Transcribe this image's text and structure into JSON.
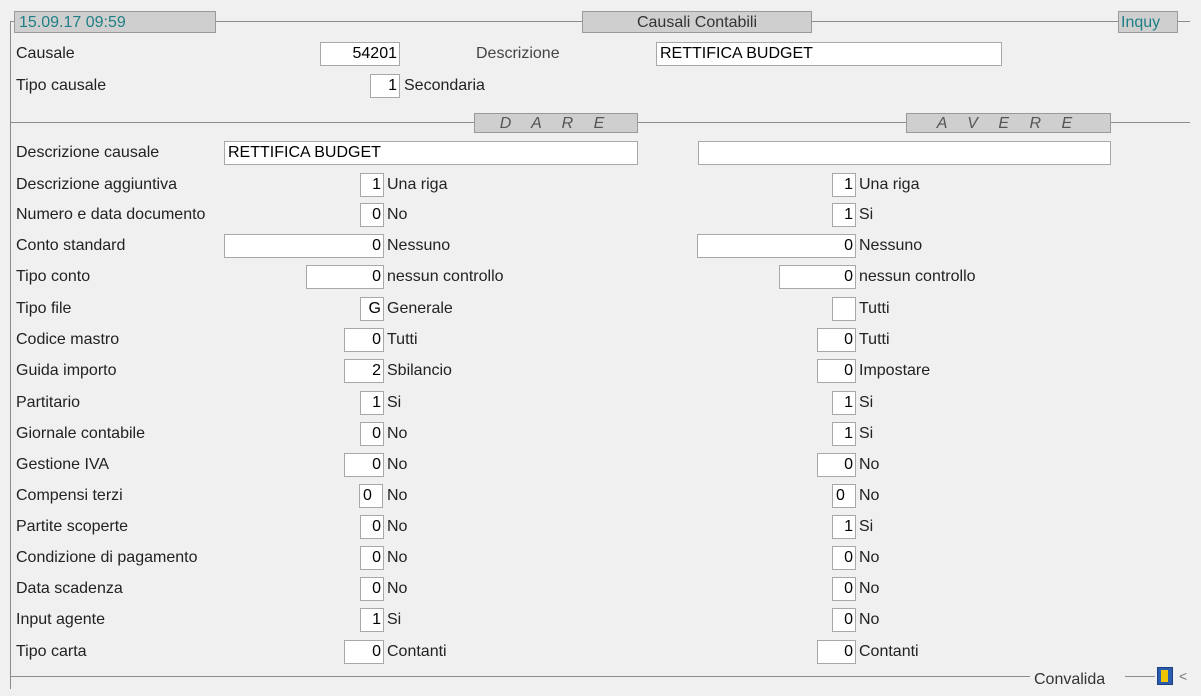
{
  "header": {
    "datetime": "15.09.17 09:59",
    "title": "Causali Contabili",
    "mode": "Inquy"
  },
  "causale": {
    "label": "Causale",
    "value": "54201"
  },
  "descrizione": {
    "label": "Descrizione",
    "value": "RETTIFICA BUDGET"
  },
  "tipo_causale": {
    "label": "Tipo causale",
    "code": "1",
    "text": "Secondaria"
  },
  "sections": {
    "dare": "D A R E",
    "avere": "A V E R E"
  },
  "rows": [
    {
      "label": "Descrizione causale",
      "dare_value": "RETTIFICA BUDGET",
      "avere_value": ""
    },
    {
      "label": "Descrizione aggiuntiva",
      "dare_code": "1",
      "dare_text": "Una riga",
      "avere_code": "1",
      "avere_text": "Una riga"
    },
    {
      "label": "Numero e data documento",
      "dare_code": "0",
      "dare_text": "No",
      "avere_code": "1",
      "avere_text": "Si"
    },
    {
      "label": "Conto standard",
      "dare_code": "0",
      "dare_text": "Nessuno",
      "avere_code": "0",
      "avere_text": "Nessuno"
    },
    {
      "label": "Tipo conto",
      "dare_code": "0",
      "dare_text": "nessun controllo",
      "avere_code": "0",
      "avere_text": "nessun controllo"
    },
    {
      "label": "Tipo file",
      "dare_code": "G",
      "dare_text": "Generale",
      "avere_code": "",
      "avere_text": "Tutti"
    },
    {
      "label": "Codice mastro",
      "dare_code": "0",
      "dare_text": "Tutti",
      "avere_code": "0",
      "avere_text": "Tutti"
    },
    {
      "label": "Guida importo",
      "dare_code": "2",
      "dare_text": "Sbilancio",
      "avere_code": "0",
      "avere_text": "Impostare"
    },
    {
      "label": "Partitario",
      "dare_code": "1",
      "dare_text": "Si",
      "avere_code": "1",
      "avere_text": "Si"
    },
    {
      "label": "Giornale contabile",
      "dare_code": "0",
      "dare_text": "No",
      "avere_code": "1",
      "avere_text": "Si"
    },
    {
      "label": "Gestione IVA",
      "dare_code": "0",
      "dare_text": "No",
      "avere_code": "0",
      "avere_text": "No"
    },
    {
      "label": "Compensi terzi",
      "dare_code": "0",
      "dare_text": "No",
      "avere_code": "0",
      "avere_text": "No"
    },
    {
      "label": "Partite scoperte",
      "dare_code": "0",
      "dare_text": "No",
      "avere_code": "1",
      "avere_text": "Si"
    },
    {
      "label": "Condizione di pagamento",
      "dare_code": "0",
      "dare_text": "No",
      "avere_code": "0",
      "avere_text": "No"
    },
    {
      "label": "Data scadenza",
      "dare_code": "0",
      "dare_text": "No",
      "avere_code": "0",
      "avere_text": "No"
    },
    {
      "label": "Input agente",
      "dare_code": "1",
      "dare_text": "Si",
      "avere_code": "0",
      "avere_text": "No"
    },
    {
      "label": "Tipo carta",
      "dare_code": "0",
      "dare_text": "Contanti",
      "avere_code": "0",
      "avere_text": "Contanti"
    }
  ],
  "footer": {
    "convalida": "Convalida"
  },
  "colors": {
    "accent": "#1f7f86",
    "frame": "#8c8c8c",
    "badge": "#cfcfcf",
    "icon_blue": "#2a5db0",
    "icon_yellow": "#f0c400"
  }
}
